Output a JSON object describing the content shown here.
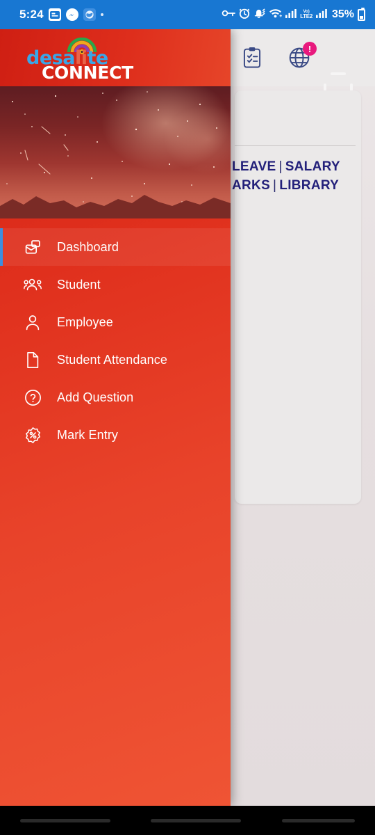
{
  "status_bar": {
    "time": "5:24",
    "battery_percent": "35%",
    "left_icons": [
      "message-card-icon",
      "messenger-icon",
      "browser-app-icon",
      "more-dot-icon"
    ],
    "right_icons": [
      "vpn-key-icon",
      "alarm-icon",
      "mute-bell-icon",
      "wifi-icon",
      "signal-icon",
      "volte-icon",
      "signal-icon",
      "battery-icon"
    ],
    "volte_top": "Vo)",
    "volte_bottom": "LTE2",
    "background_color": "#1877d2"
  },
  "app_header": {
    "icons": [
      {
        "name": "clipboard-checklist-icon",
        "badge": null
      },
      {
        "name": "globe-icon",
        "badge": "!"
      }
    ],
    "badge_color": "#e8197d"
  },
  "content_card": {
    "menu_links_row1": {
      "first": "LEAVE",
      "separator": "|",
      "second": "SALARY"
    },
    "menu_links_row2": {
      "first": "ARKS",
      "separator": "|",
      "second": "LIBRARY"
    },
    "link_color": "#23207a"
  },
  "drawer": {
    "logo": {
      "line1_prefix": "desa",
      "line1_vowel": "li",
      "line1_suffix": "te",
      "line2": "CONNECT",
      "arc_icon": "rainbow-wifi-arc-icon"
    },
    "banner_alt": "starry-night-sky-banner",
    "accent_color": "#3d8ee0",
    "items": [
      {
        "label": "Dashboard",
        "icon": "dashboard-cards-icon",
        "active": true
      },
      {
        "label": "Student",
        "icon": "people-group-icon",
        "active": false
      },
      {
        "label": "Employee",
        "icon": "person-icon",
        "active": false
      },
      {
        "label": "Student Attendance",
        "icon": "document-page-icon",
        "active": false
      },
      {
        "label": "Add Question",
        "icon": "question-circle-icon",
        "active": false
      },
      {
        "label": "Mark Entry",
        "icon": "percent-badge-icon",
        "active": false
      }
    ]
  },
  "system_nav": {
    "buttons": [
      "recents-button",
      "home-button",
      "back-button"
    ]
  }
}
